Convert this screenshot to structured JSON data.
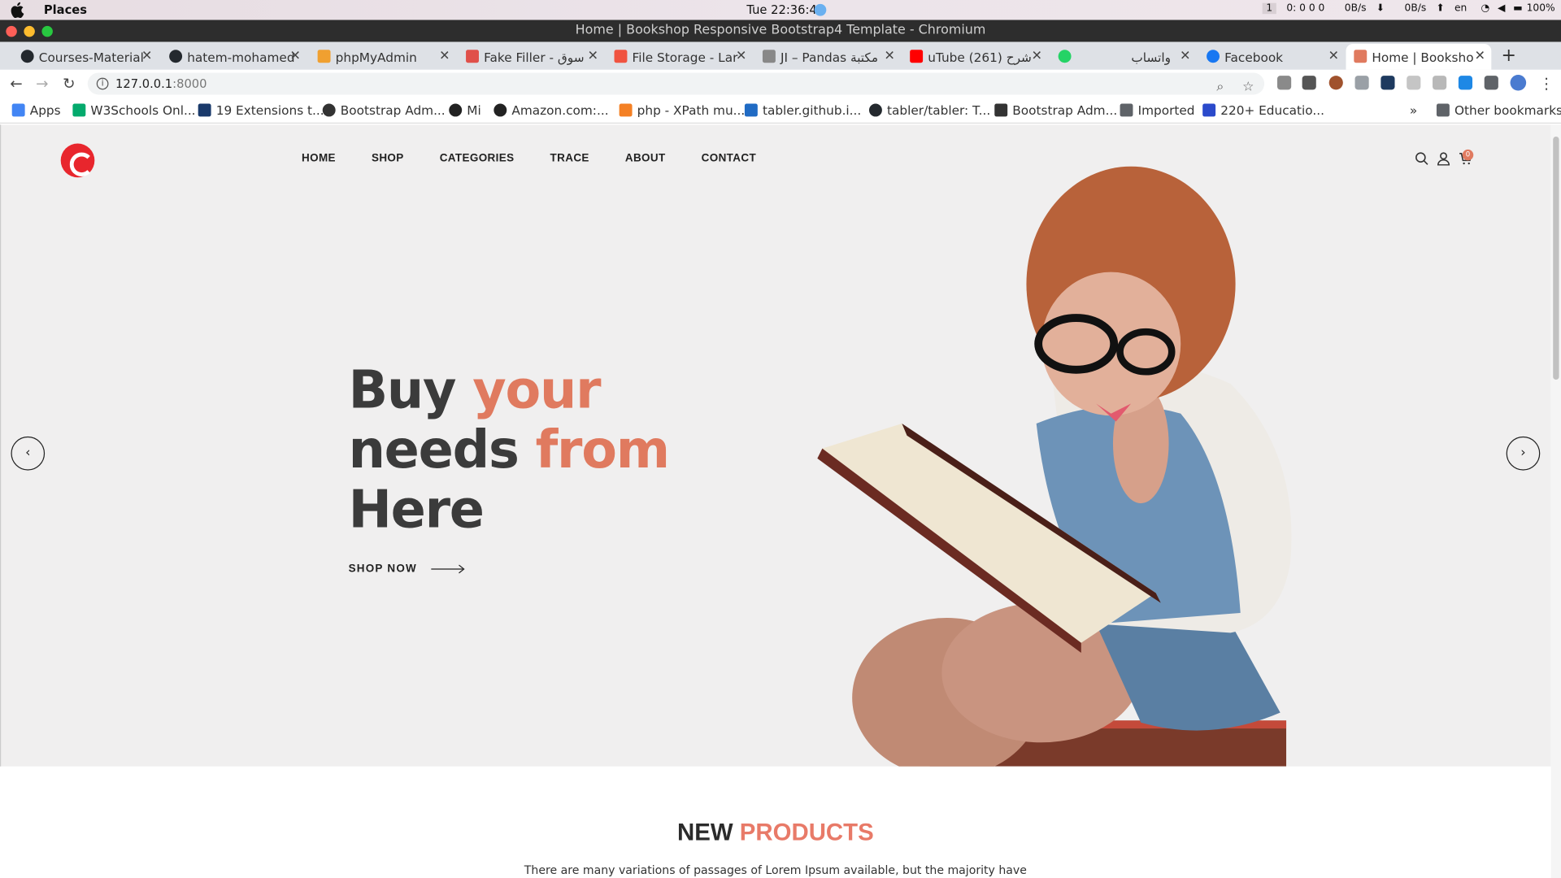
{
  "menubar": {
    "app_name": "Places",
    "clock": "Tue 22:36:40",
    "tray": [
      "1",
      "0: 0 0 0",
      "0B/s",
      "⬇",
      "0B/s",
      "⬆",
      "en",
      "100%"
    ]
  },
  "window": {
    "title": "Home | Bookshop Responsive Bootstrap4 Template - Chromium"
  },
  "tabs": [
    {
      "label": "Courses-Material",
      "favicon_color": "#24292e"
    },
    {
      "label": "hatem-mohamed",
      "favicon_color": "#24292e"
    },
    {
      "label": "phpMyAdmin",
      "favicon_color": "#f0a030"
    },
    {
      "label": "Fake Filler - سوق",
      "favicon_color": "#e0504a"
    },
    {
      "label": "File Storage - Lar",
      "favicon_color": "#f05340"
    },
    {
      "label": "JI – Pandas مكتبة",
      "favicon_color": "#888888"
    },
    {
      "label": "uTube (261) شرح",
      "favicon_color": "#ff0000"
    },
    {
      "label": "واتساب",
      "favicon_color": "#25d366"
    },
    {
      "label": "Facebook",
      "favicon_color": "#1877f2"
    },
    {
      "label": "Home | Booksho",
      "favicon_color": "#e07a5f"
    }
  ],
  "address_bar": {
    "host": "127.0.0.1",
    "port": ":8000"
  },
  "bookmarks": [
    {
      "label": "Apps",
      "color": "#4285f4"
    },
    {
      "label": "W3Schools Onl...",
      "color": "#04aa6d"
    },
    {
      "label": "19 Extensions t...",
      "color": "#1a3a6b"
    },
    {
      "label": "Bootstrap Adm...",
      "color": "#333333"
    },
    {
      "label": "Mi",
      "color": "#222222"
    },
    {
      "label": "Amazon.com:...",
      "color": "#222222"
    },
    {
      "label": "php - XPath mu...",
      "color": "#f48024"
    },
    {
      "label": "tabler.github.i...",
      "color": "#206bc4"
    },
    {
      "label": "tabler/tabler: T...",
      "color": "#24292e"
    },
    {
      "label": "Bootstrap Adm...",
      "color": "#333333"
    },
    {
      "label": "Imported",
      "color": "#5f6368"
    },
    {
      "label": "220+ Educatio...",
      "color": "#2b4acb"
    }
  ],
  "other_bookmarks": "Other bookmarks",
  "site": {
    "nav": [
      "HOME",
      "SHOP",
      "CATEGORIES",
      "TRACE",
      "ABOUT",
      "CONTACT"
    ],
    "cart_count": "0",
    "headline": {
      "w1": "Buy",
      "w2": "your",
      "w3": "needs",
      "w4": "from",
      "w5": "Here"
    },
    "cta": "SHOP NOW",
    "prev": "‹",
    "next": "›",
    "section_title_a": "NEW",
    "section_title_b": "PRODUCTS",
    "section_text": "There are many variations of passages of Lorem Ipsum available, but the majority have",
    "accent_color": "#e07a5f"
  }
}
